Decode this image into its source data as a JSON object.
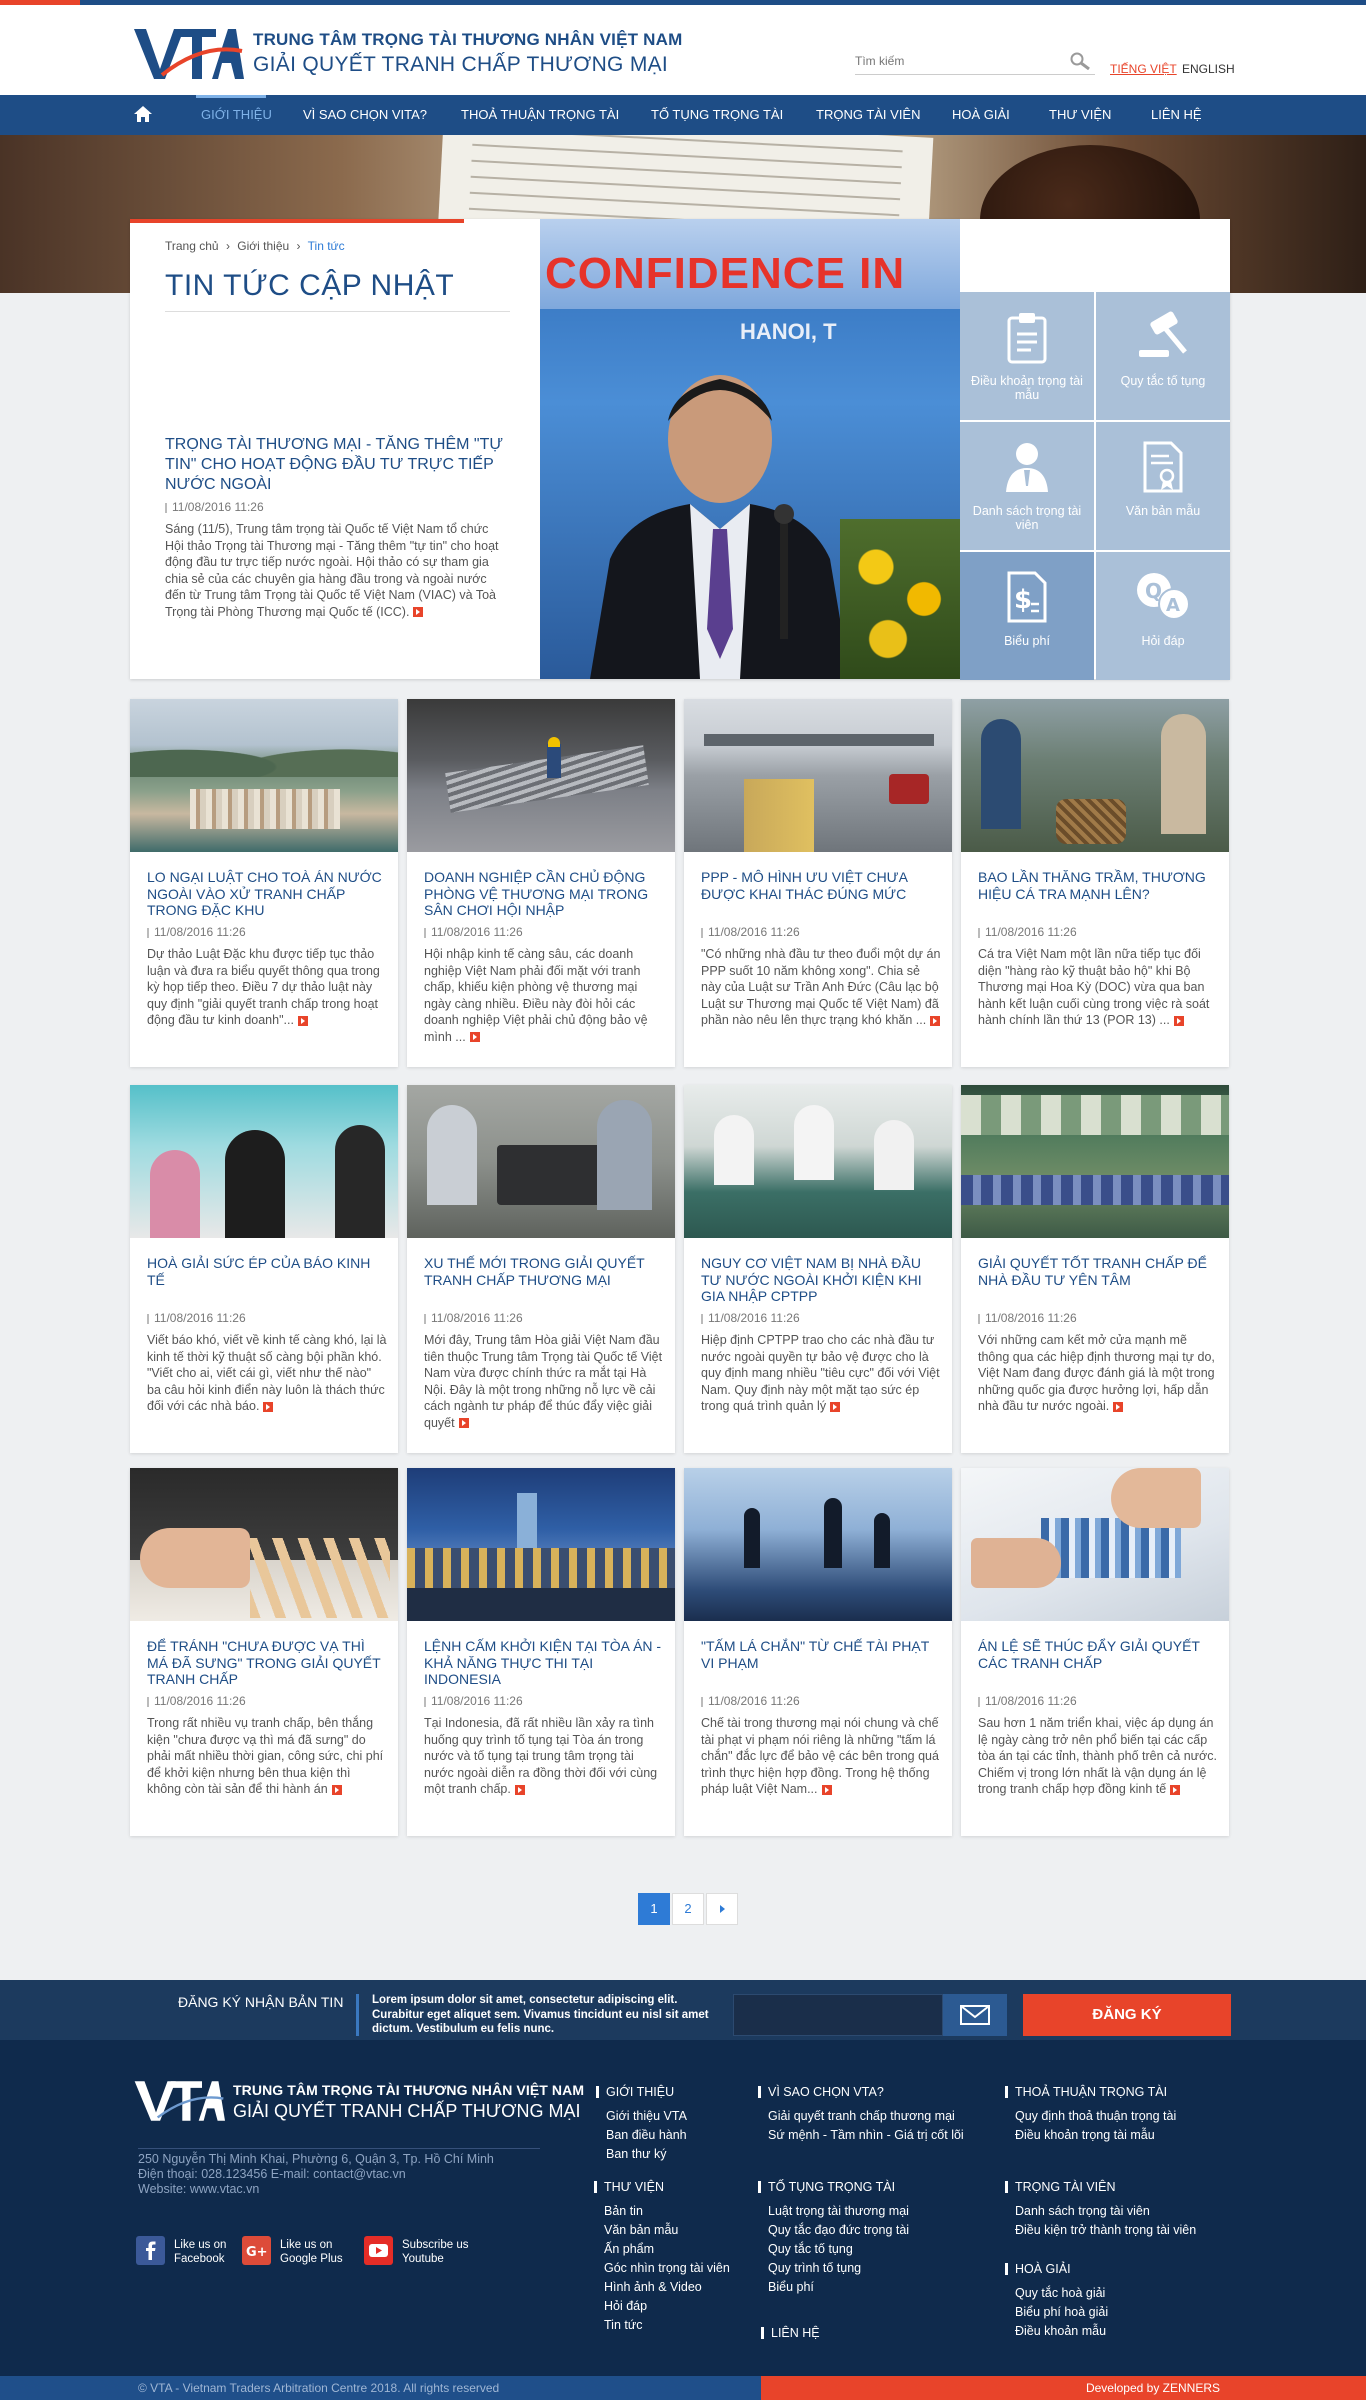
{
  "brand": {
    "logo": "VTA",
    "line1": "TRUNG TÂM TRỌNG TÀI THƯƠNG NHÂN VIỆT NAM",
    "line2": "GIẢI QUYẾT TRANH CHẤP THƯƠNG MẠI"
  },
  "header": {
    "search_placeholder": "Tìm kiếm",
    "lang_vi": "TIẾNG VIỆT",
    "lang_en": "ENGLISH",
    "icons": [
      "search-icon",
      "home-icon"
    ]
  },
  "nav": {
    "items": [
      "GIỚI THIỆU",
      "VÌ SAO CHỌN VITA?",
      "THOẢ THUẬN TRỌNG TÀI",
      "TỐ TỤNG TRỌNG TÀI",
      "TRỌNG TÀI VIÊN",
      "HOÀ GIẢI",
      "THƯ VIỆN",
      "LIÊN HỆ"
    ],
    "active": "GIỚI THIỆU"
  },
  "breadcrumb": [
    "Trang chủ",
    "Giới thiệu",
    "Tin tức"
  ],
  "page_title": "TIN TỨC CẬP NHẬT",
  "feature": {
    "title": "TRỌNG TÀI THƯƠNG MẠI - TĂNG THÊM \"TỰ TIN\" CHO HOẠT ĐỘNG ĐẦU TƯ TRỰC TIẾP NƯỚC NGOÀI",
    "date": "11/08/2016 11:26",
    "desc": "Sáng (11/5), Trung tâm trọng tài Quốc tế Việt Nam tổ chức Hội thảo Trọng tài Thương mại - Tăng thêm \"tự tin\" cho hoạt động đầu tư trực tiếp nước ngoài. Hội thảo có sự tham gia chia sẻ của các chuyên gia hàng đầu trong và ngoài nước đến từ Trung tâm Trọng tài Quốc tế Việt Nam (VIAC) và Toà Trọng tài Phòng Thương mại Quốc tế (ICC).",
    "photo_banner": "CONFIDENCE IN",
    "photo_banner2": "HANOI, T"
  },
  "quick_links": [
    {
      "label": "Điều khoản trọng tài mẫu",
      "icon": "clipboard-icon"
    },
    {
      "label": "Quy tắc tố tụng",
      "icon": "gavel-icon"
    },
    {
      "label": "Danh sách trọng tài viên",
      "icon": "person-icon"
    },
    {
      "label": "Văn bản mẫu",
      "icon": "certificate-icon"
    },
    {
      "label": "Biểu phí",
      "icon": "fee-icon"
    },
    {
      "label": "Hỏi đáp",
      "icon": "qa-icon"
    }
  ],
  "articles": [
    {
      "title": "LO NGẠI LUẬT CHO TOÀ ÁN NƯỚC NGOÀI VÀO XỬ TRANH CHẤP TRONG ĐẶC KHU",
      "date": "11/08/2016 11:26",
      "desc": "Dự thảo Luật Đặc khu được tiếp tục thảo luận và đưa ra biểu quyết thông qua trong kỳ họp tiếp theo. Điều 7 dự thảo luật này quy định \"giải quyết tranh chấp trong hoạt động đầu tư kinh doanh\"..."
    },
    {
      "title": "DOANH NGHIỆP CẦN CHỦ ĐỘNG PHÒNG VỆ THƯƠNG MẠI TRONG SÂN CHƠI HỘI NHẬP",
      "date": "11/08/2016 11:26",
      "desc": "Hội nhập kinh tế càng sâu, các doanh nghiệp Việt Nam phải đối mặt với tranh chấp, khiếu kiện phòng vệ thương mại ngày càng nhiều. Điều này đòi hỏi các doanh nghiệp Việt phải chủ động bảo vệ mình ..."
    },
    {
      "title": "PPP - MÔ HÌNH ƯU VIỆT CHƯA ĐƯỢC KHAI THÁC ĐÚNG MỨC",
      "date": "11/08/2016 11:26",
      "desc": "\"Có những nhà đầu tư theo đuổi một dự án PPP suốt 10 năm không xong\". Chia sẻ này của Luật sư Trần Anh Đức (Câu lạc bộ Luật sư Thương mại Quốc tế Việt Nam) đã phần nào nêu lên thực trạng khó khăn ..."
    },
    {
      "title": "BAO LẦN THĂNG TRẦM, THƯƠNG HIỆU CÁ TRA MẠNH LÊN?",
      "date": "11/08/2016 11:26",
      "desc": "Cá tra Việt Nam một lần nữa tiếp tục đối diện \"hàng rào kỹ thuật bảo hộ\" khi Bộ Thương mại Hoa Kỳ (DOC) vừa qua ban hành kết luận cuối cùng trong việc rà soát hành chính lần thứ 13 (POR 13) ..."
    },
    {
      "title": "HOÀ GIẢI SỨC ÉP CỦA BÁO KINH TẾ",
      "date": "11/08/2016 11:26",
      "desc": "Viết báo khó, viết về kinh tế càng khó, lại là kinh tế thời kỹ thuật số càng bội phần khó. \"Viết cho ai, viết cái gì, viết như thế nào\" ba câu hỏi kinh điển này luôn là thách thức đối với các nhà báo."
    },
    {
      "title": "XU THẾ MỚI TRONG GIẢI QUYẾT TRANH CHẤP THƯƠNG MẠI",
      "date": "11/08/2016 11:26",
      "desc": "Mới đây, Trung tâm Hòa giải Việt Nam đầu tiên thuộc Trung tâm Trọng tài Quốc tế Việt Nam vừa được chính thức ra mắt tại Hà Nội. Đây là một trong những nỗ lực về cải cách ngành tư pháp để thúc đẩy việc giải quyết"
    },
    {
      "title": "NGUY CƠ VIỆT NAM BỊ NHÀ ĐẦU TƯ NƯỚC NGOÀI KHỞI KIỆN KHI GIA NHẬP CPTPP",
      "date": "11/08/2016 11:26",
      "desc": "Hiệp định CPTPP trao cho các nhà đầu tư nước ngoài quyền tự bảo vệ được cho là quy định mang nhiều \"tiêu cực\" đối với Việt Nam. Quy định này một mặt tạo sức ép trong quá trình quản lý"
    },
    {
      "title": "GIẢI QUYẾT TỐT TRANH CHẤP ĐỂ NHÀ ĐẦU TƯ YÊN TÂM",
      "date": "11/08/2016 11:26",
      "desc": "Với những cam kết mở cửa mạnh mẽ thông qua các hiệp định thương mại tự do, Việt Nam đang được đánh giá là một trong những quốc gia được hưởng lợi, hấp dẫn nhà đầu tư nước ngoài."
    },
    {
      "title": "ĐỂ TRÁNH \"CHƯA ĐƯỢC VẠ THÌ MÁ ĐÃ SƯNG\" TRONG GIẢI QUYẾT TRANH CHẤP",
      "date": "11/08/2016 11:26",
      "desc": "Trong rất nhiều vụ tranh chấp, bên thắng kiện \"chưa được vạ thì má đã sưng\" do phải mất nhiều thời gian, công sức, chi phí để khởi kiện nhưng bên thua kiện thì không còn tài sản để thi hành án"
    },
    {
      "title": "LỆNH CẤM KHỞI KIỆN TẠI TÒA ÁN - KHẢ NĂNG THỰC THI TẠI INDONESIA",
      "date": "11/08/2016 11:26",
      "desc": "Tại Indonesia, đã rất nhiều lần xảy ra tình huống quy trình tố tụng tại Tòa án trong nước và tố tụng tại trung tâm trọng tài nước ngoài diễn ra đồng thời đối với cùng một tranh chấp."
    },
    {
      "title": "\"TẤM LÁ CHẮN\" TỪ CHẾ TÀI PHẠT VI PHẠM",
      "date": "11/08/2016 11:26",
      "desc": "Chế tài trong thương mại nói chung và chế tài phạt vi phạm nói riêng là những \"tấm lá chắn\" đắc lực để bảo vệ các bên trong quá trình thực hiện hợp đồng. Trong hệ thống pháp luật Việt Nam..."
    },
    {
      "title": "ÁN LỆ SẼ THÚC ĐẨY GIẢI QUYẾT CÁC TRANH CHẤP",
      "date": "11/08/2016 11:26",
      "desc": "Sau hơn 1 năm triển khai, việc áp dụng án lệ ngày càng trở nên phổ biến tại các cấp tòa án tại các tỉnh, thành phố trên cả nước. Chiếm vị trong lớn nhất là vận dụng án lệ trong tranh chấp hợp đồng kinh tế"
    }
  ],
  "pagination": {
    "pages": [
      "1",
      "2"
    ],
    "current": "1",
    "next_icon": "chevron-right-icon"
  },
  "newsletter": {
    "label": "ĐĂNG KÝ NHẬN BẢN TIN",
    "text": "Lorem ipsum dolor sit amet, consectetur adipiscing elit. Curabitur eget aliquet sem. Vivamus tincidunt eu nisl sit amet dictum. Vestibulum eu felis nunc.",
    "button": "ĐĂNG KÝ",
    "mail_icon": "mail-icon"
  },
  "footer": {
    "address": "250 Nguyễn Thị Minh Khai, Phường 6, Quận 3, Tp. Hồ Chí Minh",
    "phone_email": "Điện thoại: 028.123456 E-mail: contact@vtac.vn",
    "website": "Website: www.vtac.vn",
    "social": [
      {
        "line1": "Like us on",
        "line2": "Facebook",
        "icon": "facebook-icon",
        "color": "#3b5998"
      },
      {
        "line1": "Like us on",
        "line2": "Google Plus",
        "icon": "google-plus-icon",
        "color": "#dd4b39"
      },
      {
        "line1": "Subscribe us",
        "line2": "Youtube",
        "icon": "youtube-icon",
        "color": "#e52d27"
      }
    ],
    "col1": [
      {
        "heading": "GIỚI THIỆU",
        "links": [
          "Giới thiệu VTA",
          "Ban điều hành",
          "Ban thư ký"
        ]
      },
      {
        "heading": "THƯ VIỆN",
        "links": [
          "Bản tin",
          "Văn bản mẫu",
          "Ấn phẩm",
          "Góc nhìn trọng tài viên",
          "Hình ảnh & Video",
          "Hỏi đáp",
          "Tin tức"
        ]
      }
    ],
    "col2": [
      {
        "heading": "VÌ SAO CHỌN VTA?",
        "links": [
          "Giải quyết tranh chấp thương mại",
          "Sứ mệnh - Tầm nhìn - Giá trị cốt lõi"
        ]
      },
      {
        "heading": "TỐ TỤNG TRỌNG TÀI",
        "links": [
          "Luật trọng tài thương mại",
          "Quy tắc đạo đức trọng tài",
          "Quy tắc tố tụng",
          "Quy trình tố tụng",
          "Biểu phí"
        ]
      },
      {
        "heading": "LIÊN HỆ",
        "links": []
      }
    ],
    "col3": [
      {
        "heading": "THOẢ THUẬN TRỌNG TÀI",
        "links": [
          "Quy định thoả thuận trọng tài",
          "Điều khoản trọng tài mẫu"
        ]
      },
      {
        "heading": "TRỌNG TÀI VIÊN",
        "links": [
          "Danh sách trọng tài viên",
          "Điều kiện trở thành trọng tài viên"
        ]
      },
      {
        "heading": "HOÀ GIẢI",
        "links": [
          "Quy tắc hoà giải",
          "Biểu phí hoà giải",
          "Điều khoản mẫu"
        ]
      }
    ],
    "copyright": "© VTA - Vietnam Traders Arbitration Centre 2018. All rights reserved",
    "developer": "Developed by ZENNERS"
  },
  "colors": {
    "primary": "#1e4d86",
    "accent": "#e8442a",
    "footer": "#0f2a4c",
    "tile": "#aac0d8"
  }
}
